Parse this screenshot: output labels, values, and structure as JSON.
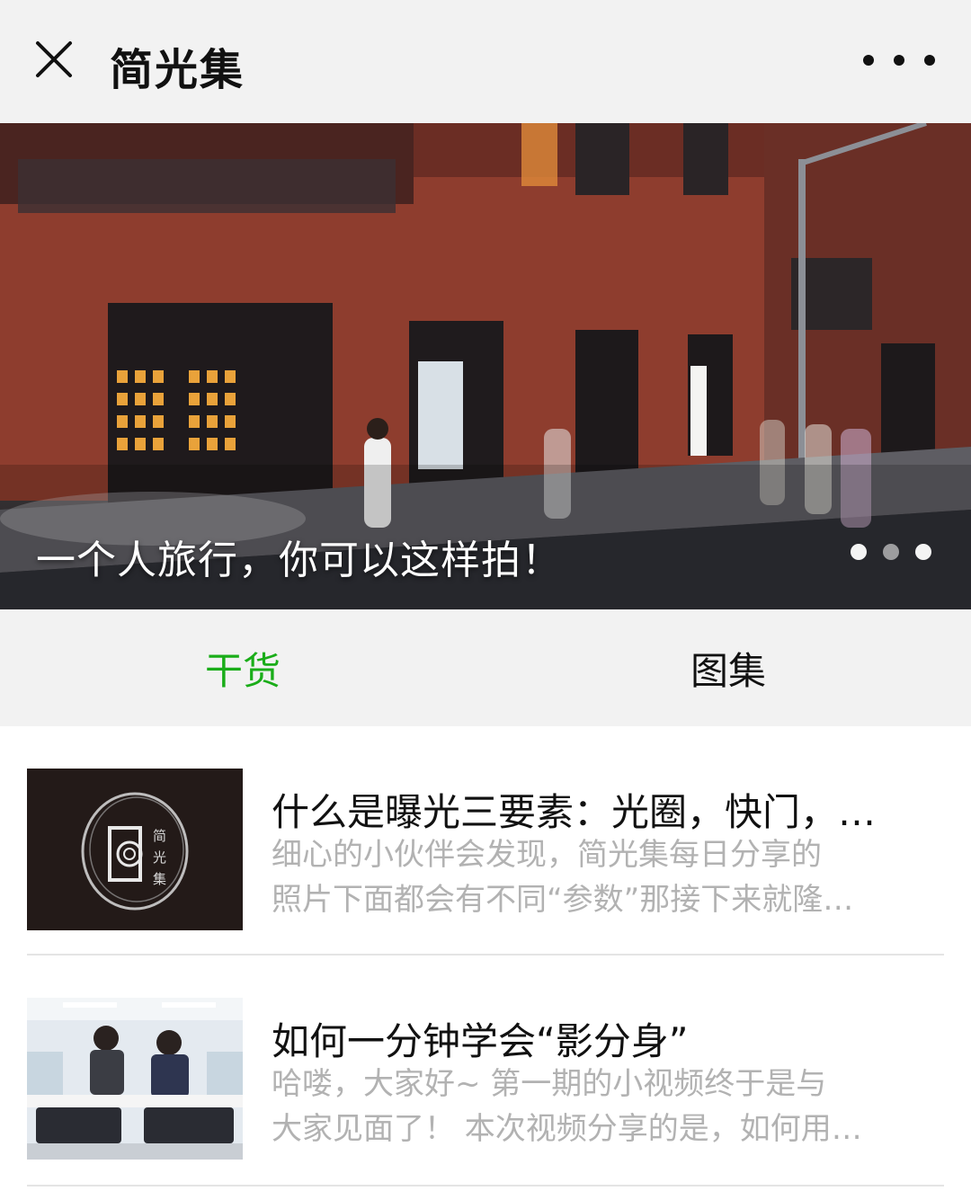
{
  "header": {
    "close_icon": "close-icon",
    "title": "简光集",
    "more_icon": "more-icon"
  },
  "banner": {
    "caption": "一个人旅行，你可以这样拍！",
    "dot_count": 3,
    "active_dot": 1
  },
  "tabs": [
    {
      "label": "干货",
      "active": true,
      "color": "#1aad19"
    },
    {
      "label": "图集",
      "active": false,
      "color": "#111111"
    }
  ],
  "articles": [
    {
      "title": "什么是曝光三要素：光圈，快门，…",
      "desc_line1": "细心的小伙伴会发现，简光集每日分享的",
      "desc_line2": "照片下面都会有不同“参数”那接下来就隆…",
      "thumb_logo_text": "简光集"
    },
    {
      "title": "如何一分钟学会“影分身”",
      "desc_line1": "哈喽，大家好~ 第一期的小视频终于是与",
      "desc_line2": "大家见面了！ 本次视频分享的是，如何用…"
    }
  ]
}
